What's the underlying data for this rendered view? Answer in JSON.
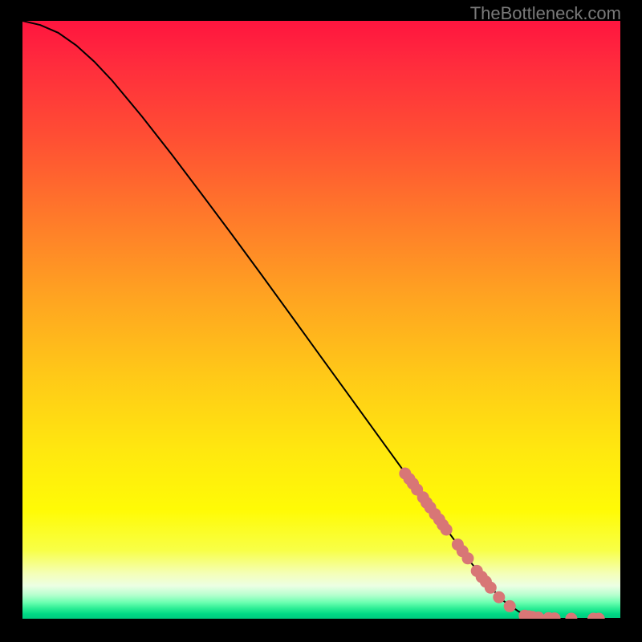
{
  "attribution": "TheBottleneck.com",
  "colors": {
    "curve": "#000000",
    "dot_fill": "#d87676",
    "dot_stroke": "#d87676"
  },
  "chart_data": {
    "type": "line",
    "title": "",
    "xlabel": "",
    "ylabel": "",
    "xlim": [
      0,
      100
    ],
    "ylim": [
      0,
      100
    ],
    "grid": false,
    "series": [
      {
        "name": "bottleneck-curve",
        "x": [
          0,
          3,
          6,
          9,
          12,
          15,
          20,
          25,
          30,
          35,
          40,
          45,
          50,
          55,
          60,
          65,
          70,
          75,
          80,
          83,
          85,
          87,
          89,
          91,
          93,
          95,
          97,
          100
        ],
        "y": [
          100,
          99.3,
          98.0,
          95.9,
          93.2,
          90.0,
          84.0,
          77.6,
          71.0,
          64.3,
          57.5,
          50.6,
          43.7,
          36.8,
          29.9,
          23.0,
          16.2,
          9.4,
          3.3,
          1.2,
          0.4,
          0.1,
          0.0,
          0.0,
          0.0,
          0.0,
          0.0,
          0.0
        ]
      }
    ],
    "scatter_on_curve": {
      "name": "highlighted-points",
      "points": [
        {
          "x": 64.0,
          "y": 24.3
        },
        {
          "x": 64.7,
          "y": 23.4
        },
        {
          "x": 65.3,
          "y": 22.6
        },
        {
          "x": 66.0,
          "y": 21.6
        },
        {
          "x": 67.0,
          "y": 20.3
        },
        {
          "x": 67.6,
          "y": 19.4
        },
        {
          "x": 68.2,
          "y": 18.6
        },
        {
          "x": 69.0,
          "y": 17.5
        },
        {
          "x": 69.7,
          "y": 16.6
        },
        {
          "x": 70.3,
          "y": 15.7
        },
        {
          "x": 70.9,
          "y": 14.9
        },
        {
          "x": 72.8,
          "y": 12.4
        },
        {
          "x": 73.6,
          "y": 11.3
        },
        {
          "x": 74.5,
          "y": 10.1
        },
        {
          "x": 76.0,
          "y": 8.0
        },
        {
          "x": 76.8,
          "y": 7.0
        },
        {
          "x": 77.5,
          "y": 6.2
        },
        {
          "x": 78.3,
          "y": 5.2
        },
        {
          "x": 79.7,
          "y": 3.6
        },
        {
          "x": 81.5,
          "y": 2.1
        },
        {
          "x": 84.0,
          "y": 0.5
        },
        {
          "x": 84.7,
          "y": 0.4
        },
        {
          "x": 85.3,
          "y": 0.3
        },
        {
          "x": 86.3,
          "y": 0.2
        },
        {
          "x": 88.0,
          "y": 0.1
        },
        {
          "x": 89.0,
          "y": 0.05
        },
        {
          "x": 91.8,
          "y": 0.0
        },
        {
          "x": 95.5,
          "y": 0.0
        },
        {
          "x": 96.4,
          "y": 0.0
        }
      ]
    }
  }
}
